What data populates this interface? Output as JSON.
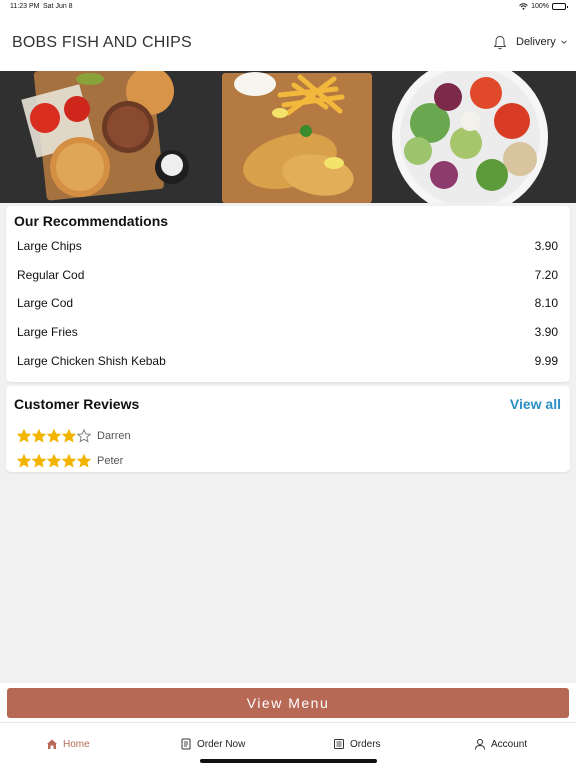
{
  "status_bar": {
    "time": "11:23 PM",
    "date": "Sat Jun 8",
    "battery": "100%",
    "battery_level": 1.0
  },
  "header": {
    "title": "BOBS FISH AND CHIPS",
    "delivery_label": "Delivery",
    "icons": [
      "bell-icon",
      "chevron-down-icon"
    ]
  },
  "recommendations": {
    "title": "Our Recommendations",
    "items": [
      {
        "name": "Large Chips",
        "price": "3.90"
      },
      {
        "name": "Regular Cod",
        "price": "7.20"
      },
      {
        "name": "Large Cod",
        "price": "8.10"
      },
      {
        "name": "Large Fries",
        "price": "3.90"
      },
      {
        "name": "Large Chicken Shish Kebab",
        "price": "9.99"
      }
    ]
  },
  "reviews": {
    "title": "Customer Reviews",
    "view_all": "View all",
    "items": [
      {
        "name": "Darren",
        "rating": 4,
        "max": 5
      },
      {
        "name": "Peter",
        "rating": 5,
        "max": 5
      }
    ]
  },
  "view_menu_label": "View Menu",
  "tabs": [
    {
      "label": "Home",
      "icon": "home-icon",
      "active": true
    },
    {
      "label": "Order Now",
      "icon": "order-icon",
      "active": false
    },
    {
      "label": "Orders",
      "icon": "orders-icon",
      "active": false
    },
    {
      "label": "Account",
      "icon": "account-icon",
      "active": false
    }
  ],
  "colors": {
    "accent": "#b86955",
    "link": "#2b8fc5",
    "star": "#f2b400",
    "background": "#f1f1f1"
  }
}
